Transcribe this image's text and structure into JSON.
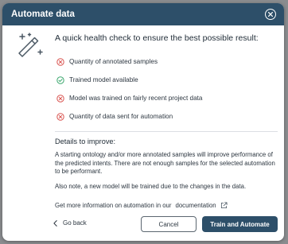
{
  "dialog": {
    "title": "Automate data",
    "heading": "A quick health check to ensure the best possible result:",
    "checks": [
      {
        "label": "Quantity of annotated samples",
        "status": "fail"
      },
      {
        "label": "Trained model available",
        "status": "pass"
      },
      {
        "label": "Model was trained on fairly recent project data",
        "status": "fail"
      },
      {
        "label": "Quantity of data sent for automation",
        "status": "fail"
      }
    ],
    "details_heading": "Details to improve:",
    "details_paragraph": "A starting ontology and/or more annotated samples will improve performance of the predicted intents. There are not enough samples for the selected automation to be performant.",
    "note_paragraph": "Also note, a new model will be trained due to the changes in the data.",
    "more_info_text": "Get more information on automation in our",
    "documentation_link": "documentation"
  },
  "footer": {
    "back_label": "Go back",
    "cancel_label": "Cancel",
    "primary_label": "Train and Automate"
  },
  "colors": {
    "header_bg": "#2d4f69",
    "fail": "#d9534f",
    "pass": "#3aa76d",
    "primary_button": "#2d4f69"
  },
  "icons": {
    "close": "close-icon",
    "wand": "magic-wand-icon",
    "fail": "error-circle-icon",
    "pass": "check-circle-icon",
    "external": "external-link-icon",
    "back": "chevron-left-icon"
  }
}
